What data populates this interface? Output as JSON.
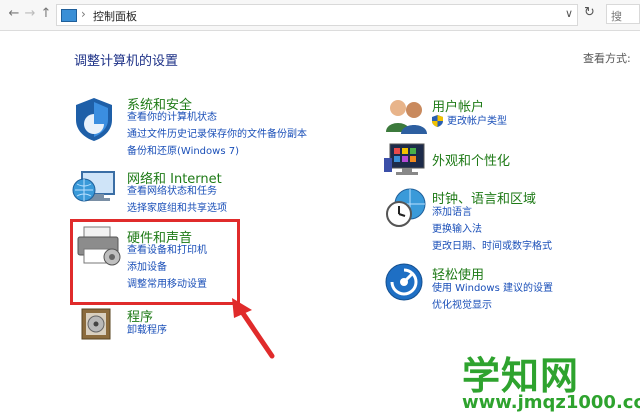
{
  "toolbar": {
    "back_icon": "left-arrow-icon",
    "up_icon": "up-arrow-icon",
    "breadcrumb_separator": "›",
    "breadcrumb": "控制面板",
    "dropdown_glyph": "∨",
    "refresh_glyph": "↻",
    "search_partial": "搜"
  },
  "main": {
    "heading": "调整计算机的设置",
    "view_by": "查看方式:"
  },
  "categories": [
    {
      "title": "系统和安全",
      "links": [
        "查看你的计算机状态",
        "通过文件历史记录保存你的文件备份副本",
        "备份和还原(Windows 7)"
      ]
    },
    {
      "title": "网络和 Internet",
      "links": [
        "查看网络状态和任务",
        "选择家庭组和共享选项"
      ]
    },
    {
      "title": "硬件和声音",
      "links": [
        "查看设备和打印机",
        "添加设备",
        "调整常用移动设置"
      ]
    },
    {
      "title": "程序",
      "links": [
        "卸载程序"
      ]
    },
    {
      "title": "用户帐户",
      "links": [
        "更改帐户类型"
      ]
    },
    {
      "title": "外观和个性化",
      "links": []
    },
    {
      "title": "时钟、语言和区域",
      "links": [
        "添加语言",
        "更换输入法",
        "更改日期、时间或数字格式"
      ]
    },
    {
      "title": "轻松使用",
      "links": [
        "使用 Windows 建议的设置",
        "优化视觉显示"
      ]
    }
  ],
  "watermark": {
    "main": "学知网",
    "url": "www.jmqz1000.com"
  },
  "colors": {
    "category": "#1e7a16",
    "link": "#1a4fb8",
    "heading": "#1e3287",
    "highlight": "#e02b2b",
    "watermark": "#2ea32e"
  }
}
